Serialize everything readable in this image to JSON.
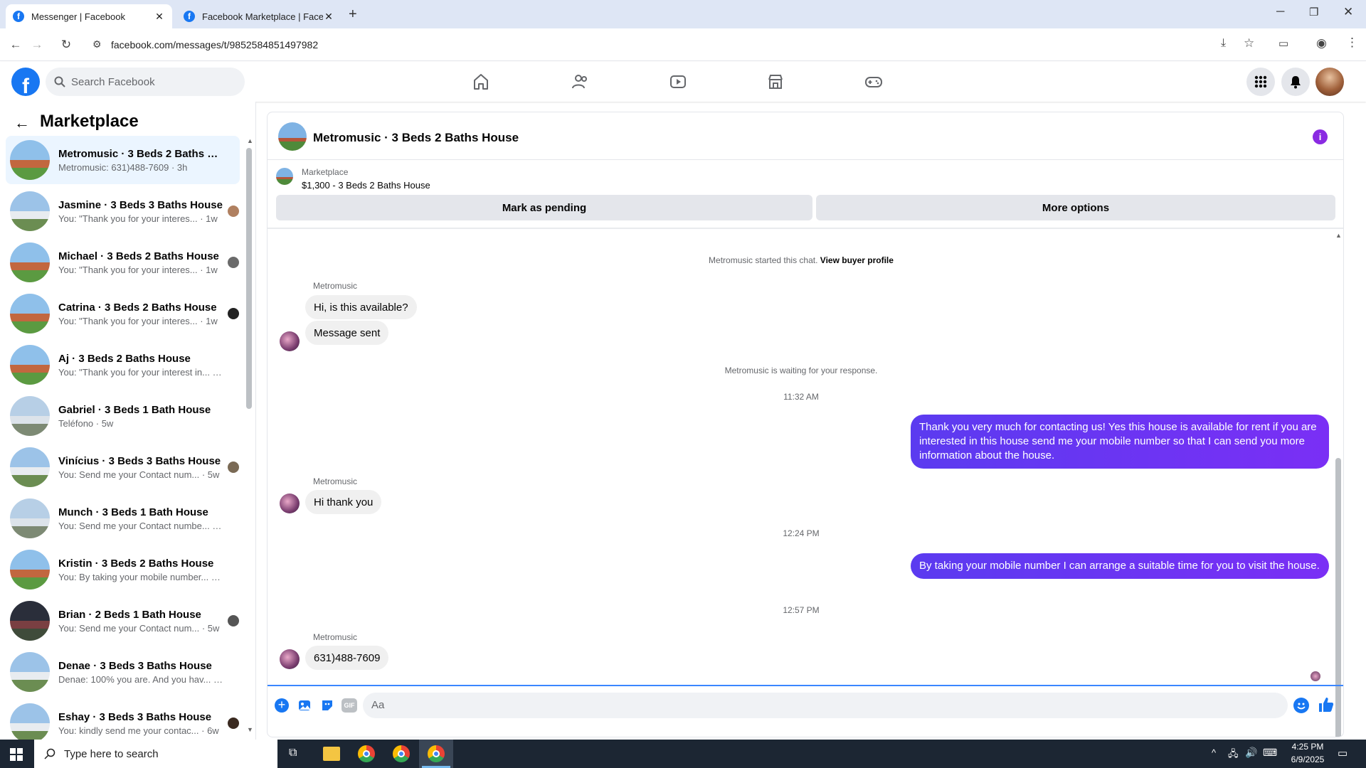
{
  "browser": {
    "tabs": [
      {
        "title": "Messenger | Facebook",
        "active": true
      },
      {
        "title": "Facebook Marketplace | Facebo",
        "active": false
      }
    ],
    "url": "facebook.com/messages/t/9852584851497982"
  },
  "fb": {
    "search_placeholder": "Search Facebook",
    "nav_icons": [
      "home-icon",
      "friends-icon",
      "watch-icon",
      "marketplace-icon",
      "gaming-icon"
    ]
  },
  "sidebar": {
    "title": "Marketplace",
    "conversations": [
      {
        "name": "Metromusic · 3 Beds 2 Baths Ho...",
        "preview": "Metromusic: 631)488-7609 · 3h",
        "thumb": "ranch",
        "selected": true,
        "seen": false
      },
      {
        "name": "Jasmine · 3 Beds 3 Baths House",
        "preview": "You: \"Thank you for your interes... · 1w",
        "thumb": "white",
        "selected": false,
        "seen": true
      },
      {
        "name": "Michael · 3 Beds 2 Baths House",
        "preview": "You: \"Thank you for your interes... · 1w",
        "thumb": "ranch",
        "selected": false,
        "seen": true
      },
      {
        "name": "Catrina · 3 Beds 2 Baths House",
        "preview": "You: \"Thank you for your interes... · 1w",
        "thumb": "ranch",
        "selected": false,
        "seen": true
      },
      {
        "name": "Aj · 3 Beds 2 Baths House",
        "preview": "You: \"Thank you for your interest in... · 1w",
        "thumb": "ranch",
        "selected": false,
        "seen": false
      },
      {
        "name": "Gabriel · 3 Beds 1 Bath House",
        "preview": "Teléfono · 5w",
        "thumb": "victorian",
        "selected": false,
        "seen": false
      },
      {
        "name": "Vinícius · 3 Beds 3 Baths House",
        "preview": "You: Send me your Contact num... · 5w",
        "thumb": "white",
        "selected": false,
        "seen": true
      },
      {
        "name": "Munch · 3 Beds 1 Bath House",
        "preview": "You: Send me your Contact numbe... · 5w",
        "thumb": "victorian",
        "selected": false,
        "seen": false
      },
      {
        "name": "Kristin · 3 Beds 2 Baths House",
        "preview": "You: By taking your mobile number... · 5w",
        "thumb": "ranch",
        "selected": false,
        "seen": false
      },
      {
        "name": "Brian · 2 Beds 1 Bath House",
        "preview": "You: Send me your Contact num... · 5w",
        "thumb": "brick",
        "selected": false,
        "seen": true
      },
      {
        "name": "Denae · 3 Beds 3 Baths House",
        "preview": "Denae: 100% you are. And you hav... · 6w",
        "thumb": "white",
        "selected": false,
        "seen": false
      },
      {
        "name": "Eshay · 3 Beds 3 Baths House",
        "preview": "You: kindly send me your contac... · 6w",
        "thumb": "white",
        "selected": false,
        "seen": true
      }
    ]
  },
  "chat": {
    "title": "Metromusic · 3 Beds 2 Baths House",
    "listing_label": "Marketplace",
    "listing_detail": "$1,300 - 3 Beds 2 Baths House",
    "mark_pending": "Mark as pending",
    "more_options": "More options",
    "started_prefix": "Metromusic started this chat.",
    "view_buyer": "View buyer profile",
    "sender_name": "Metromusic",
    "msg1": "Hi, is this available?",
    "msg2": "Message sent",
    "waiting": "Metromusic is waiting for your response.",
    "time1": "11:32 AM",
    "out1": "Thank you very much for contacting us! Yes this house is available for rent if you are interested in this house send me your mobile number so that I can send you more information about the house.",
    "msg3": "Hi thank you",
    "time2": "12:24 PM",
    "out2": "By taking your mobile number I can arrange a suitable time for you to visit the house.",
    "time3": "12:57 PM",
    "msg4": "631)488-7609",
    "composer_placeholder": "Aa"
  },
  "taskbar": {
    "search_placeholder": "Type here to search",
    "time": "4:25 PM",
    "date": "6/9/2025"
  },
  "colors": {
    "fb_blue": "#1877f2",
    "bubble_out": "#5b3bf0",
    "selected_row": "#ebf5ff",
    "info_purple": "#8a2be2"
  }
}
